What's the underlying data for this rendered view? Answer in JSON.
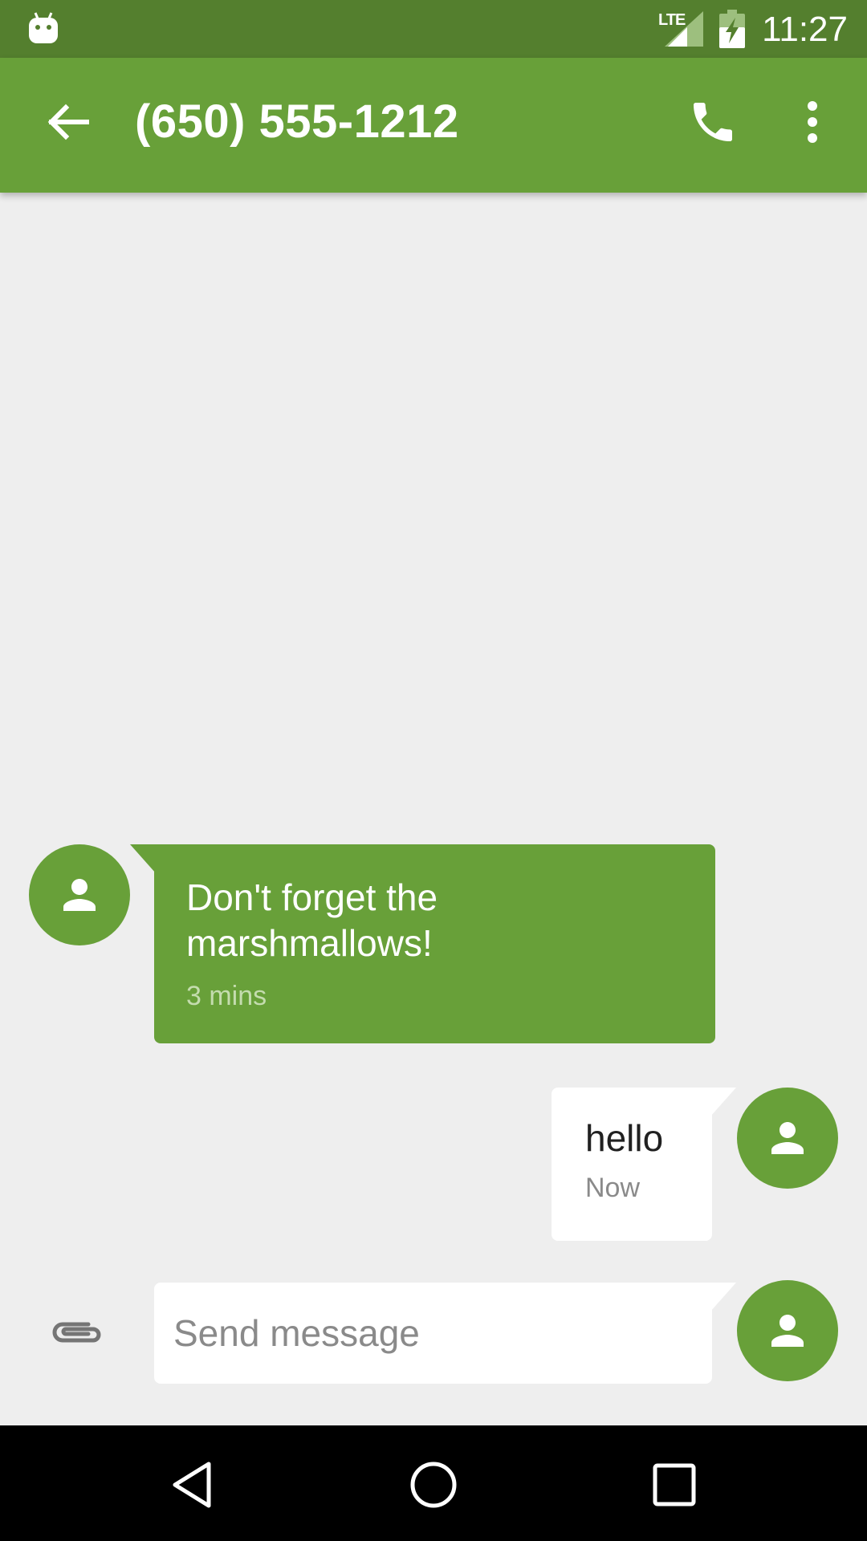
{
  "status_bar": {
    "time": "11:27",
    "network": "LTE",
    "icons": [
      "android-notification-icon",
      "signal-icon",
      "battery-charging-icon"
    ]
  },
  "app_bar": {
    "title": "(650) 555-1212",
    "icons": [
      "back-arrow-icon",
      "phone-call-icon",
      "more-vert-icon"
    ]
  },
  "messages": [
    {
      "direction": "incoming",
      "text": "Don't forget the marshmallows!",
      "time": "3 mins"
    },
    {
      "direction": "outgoing",
      "text": "hello",
      "time": "Now"
    }
  ],
  "compose": {
    "placeholder": "Send message",
    "value": ""
  },
  "nav_bar": {
    "icons": [
      "nav-back-icon",
      "nav-home-icon",
      "nav-recents-icon"
    ]
  },
  "colors": {
    "status_bar": "#547f2e",
    "app_bar": "#68a039",
    "background": "#eeeeee",
    "incoming_bubble": "#68a039",
    "outgoing_bubble": "#ffffff"
  }
}
